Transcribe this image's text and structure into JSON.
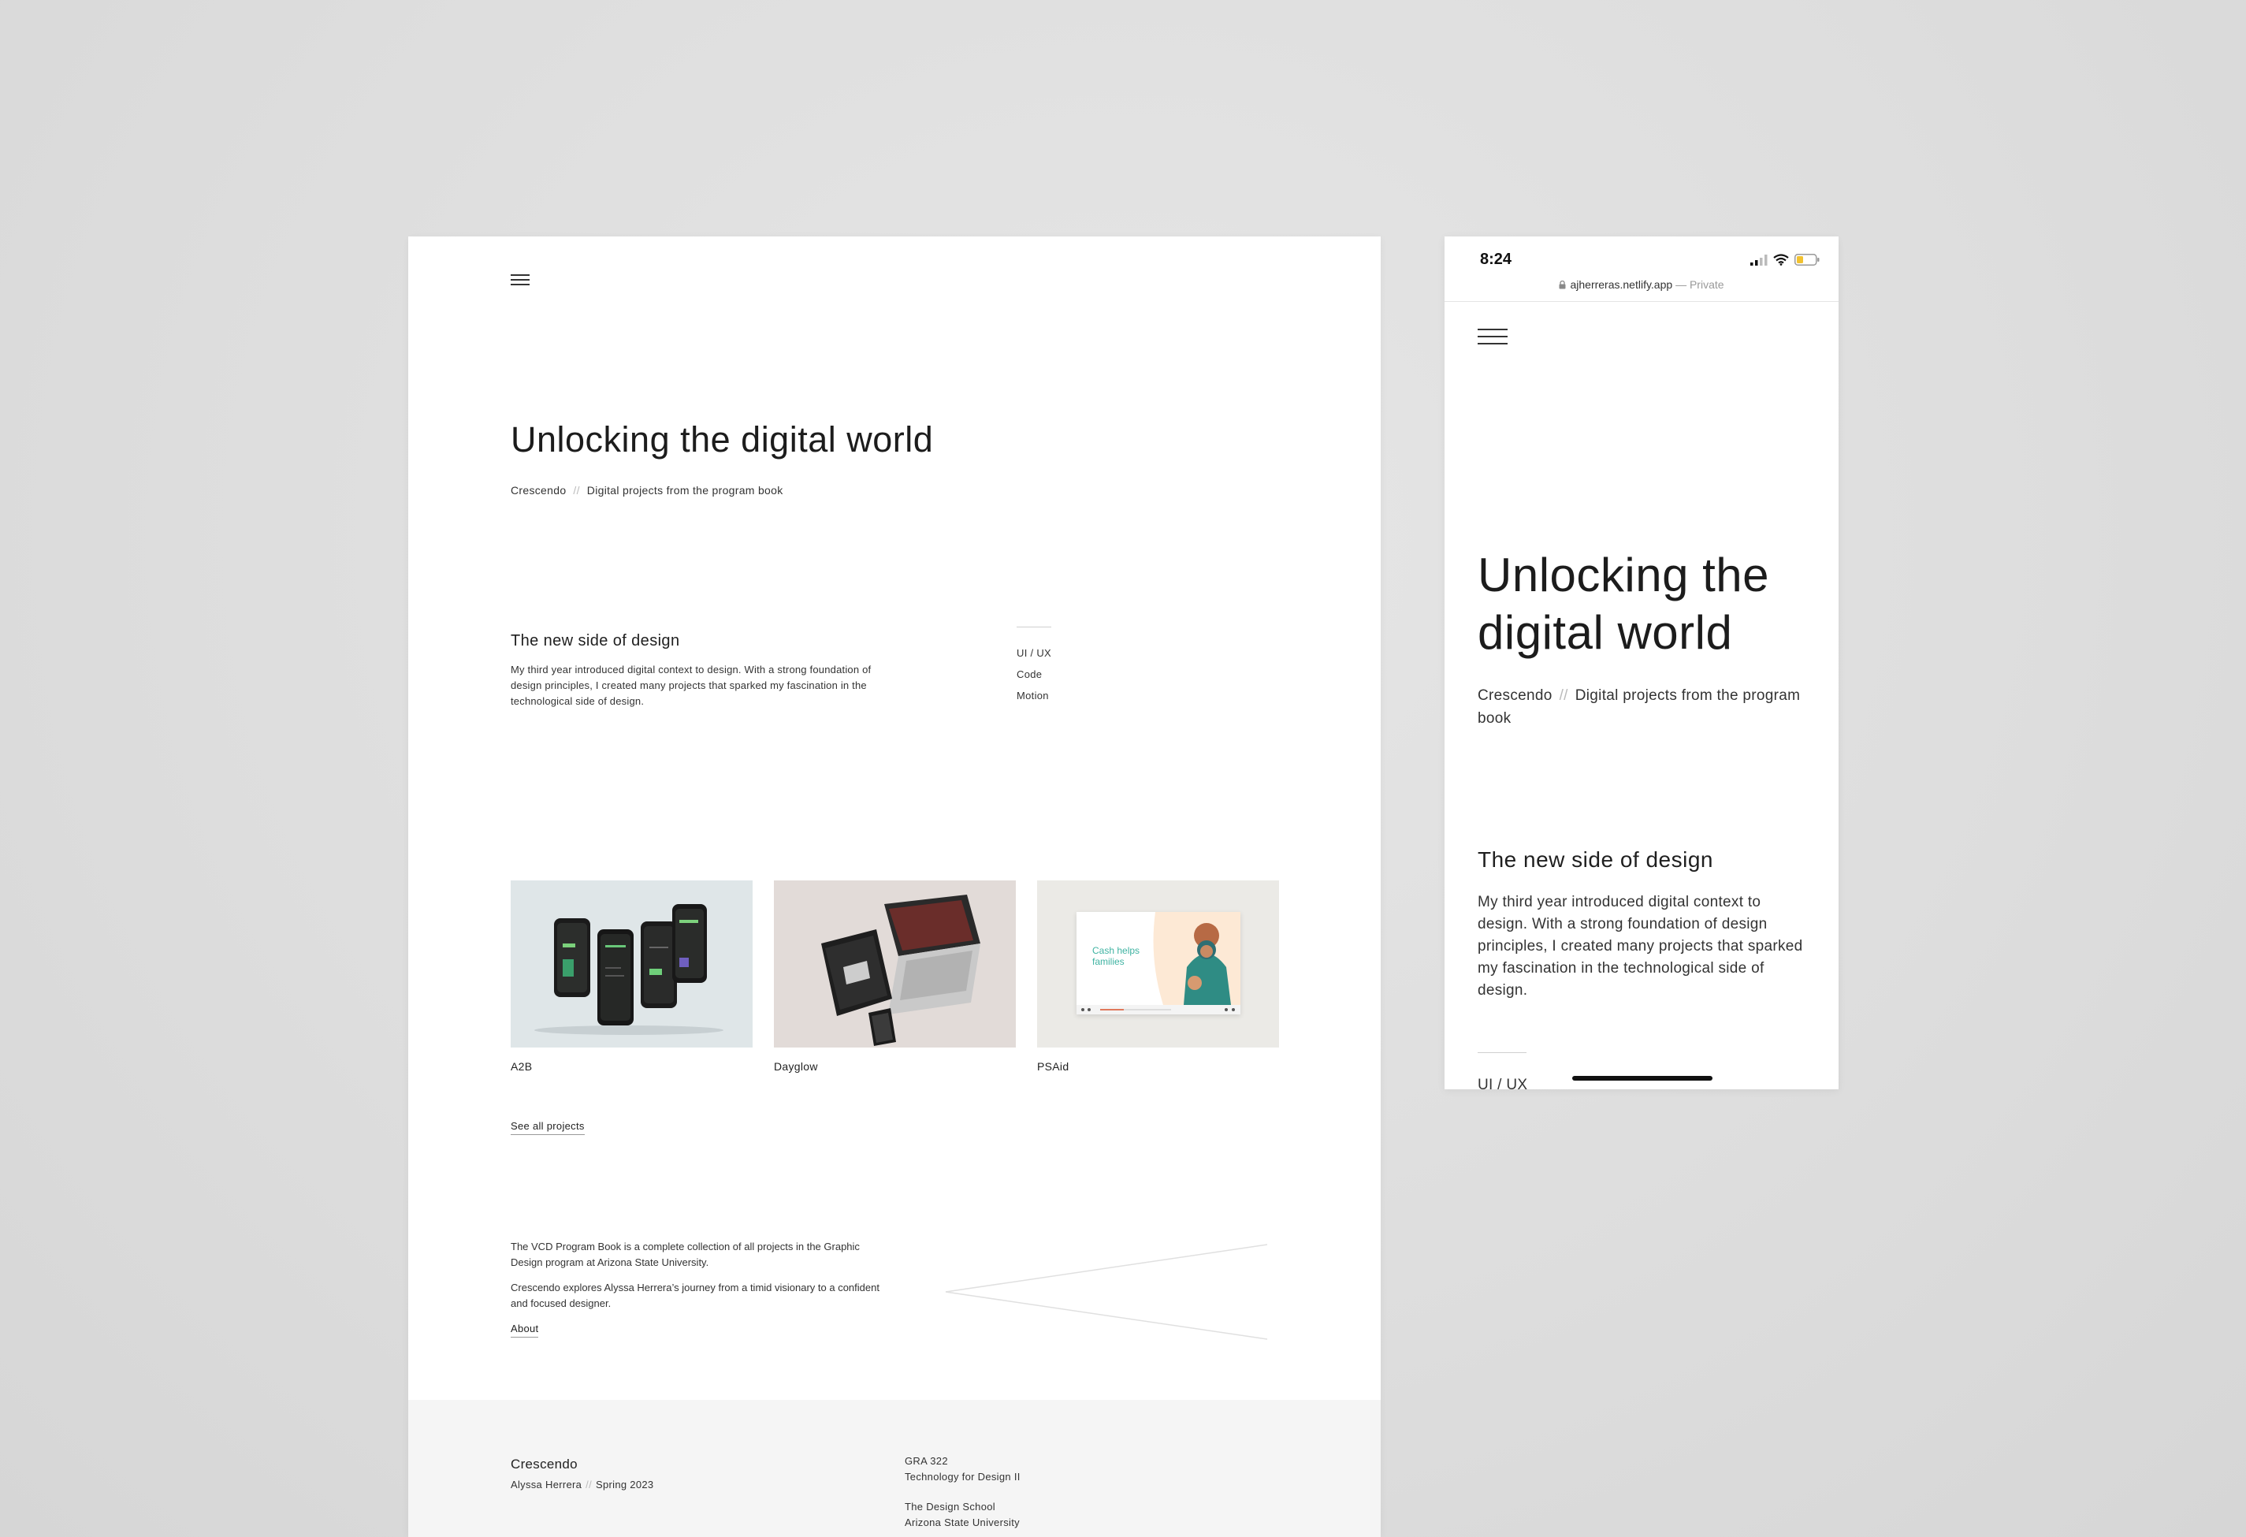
{
  "desktop": {
    "hero": {
      "title": "Unlocking the digital world",
      "crumb_1": "Crescendo",
      "crumb_sep": "//",
      "crumb_2": "Digital projects from the program book"
    },
    "intro": {
      "heading": "The new side of design",
      "body": "My third year introduced digital context to design. With a strong foundation of design principles, I created many projects that sparked my fascination in the technological side of design.",
      "tags": [
        "UI / UX",
        "Code",
        "Motion"
      ]
    },
    "projects": [
      {
        "label": "A2B"
      },
      {
        "label": "Dayglow"
      },
      {
        "label": "PSAid",
        "thumb_text": "Cash helps families"
      }
    ],
    "see_all": "See all projects",
    "about": {
      "p1": "The VCD Program Book is a complete collection of all projects in the Graphic Design program at Arizona State University.",
      "p2": "Crescendo explores Alyssa Herrera’s journey from a timid visionary to a confident and focused designer.",
      "link": "About"
    },
    "footer": {
      "name": "Crescendo",
      "author": "Alyssa Herrera",
      "sep": "//",
      "term": "Spring 2023",
      "course_code": "GRA 322",
      "course_name": "Technology for Design II",
      "school": "The Design School",
      "university": "Arizona State University"
    }
  },
  "mobile": {
    "status": {
      "time": "8:24",
      "url": "ajherreras.netlify.app",
      "url_sep": "—",
      "private": "Private"
    },
    "hero": {
      "title": "Unlocking the digital world",
      "crumb_1": "Crescendo",
      "crumb_sep": "//",
      "crumb_2": "Digital projects from the program book"
    },
    "intro": {
      "heading": "The new side of design",
      "body": "My third year introduced digital context to design. With a strong foundation of design principles, I created many projects that sparked my fascination in the technological side of design.",
      "first_tag": "UI / UX"
    }
  },
  "colors": {
    "backdrop": "#dfdfdf",
    "footer_bg": "#f5f5f5",
    "text": "#1f1f1f",
    "battery": "#f2c230"
  }
}
